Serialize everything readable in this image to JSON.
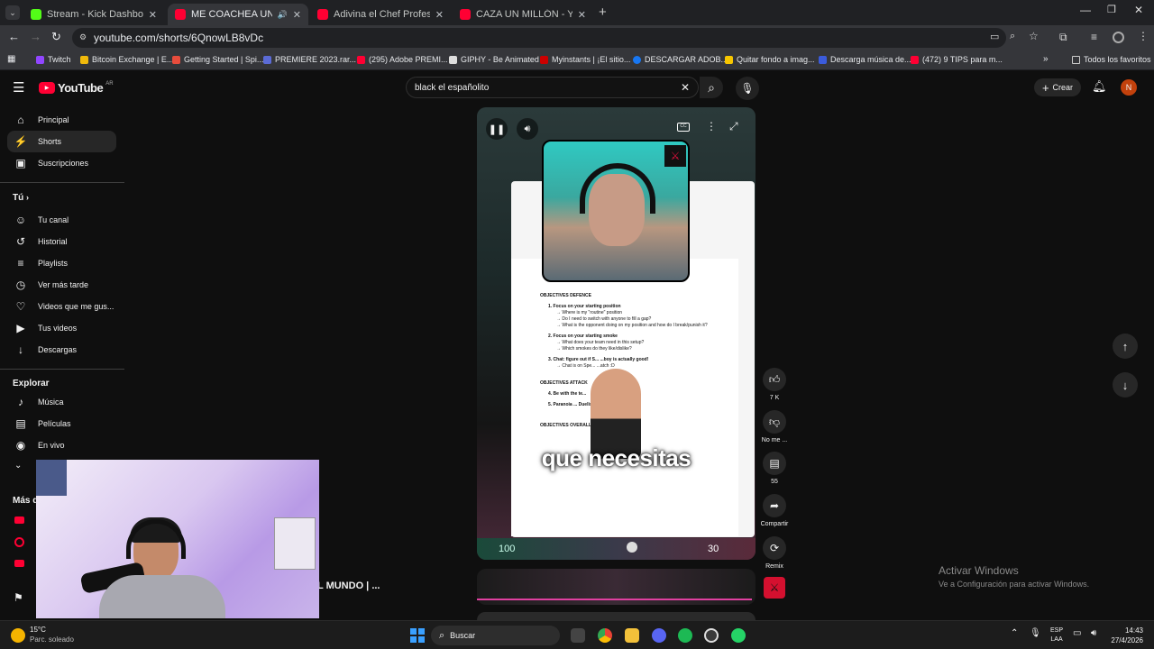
{
  "browser": {
    "tabs": [
      {
        "title": "Stream - Kick Dashboard",
        "color": "#53fc18"
      },
      {
        "title": "ME COACHEA UN EX CAM",
        "color": "#ff0033"
      },
      {
        "title": "Adivina el Chef Profesional - Yo",
        "color": "#ff0033"
      },
      {
        "title": "CAZA UN MILLÓN - YouTube",
        "color": "#ff0033"
      }
    ],
    "url": "youtube.com/shorts/6QnowLB8vDc",
    "bookmarks": [
      {
        "label": "Twitch",
        "color": "#9146ff"
      },
      {
        "label": "Bitcoin Exchange | E...",
        "color": "#f0b90b"
      },
      {
        "label": "Getting Started | Spi...",
        "color": "#e74c3c"
      },
      {
        "label": "PREMIERE 2023.rar...",
        "color": "#5b6bd6"
      },
      {
        "label": "(295) Adobe PREMI...",
        "color": "#ff0033"
      },
      {
        "label": "GIPHY - Be Animated",
        "color": "#dddddd"
      },
      {
        "label": "Myinstants | ¡El sitio...",
        "color": "#cc0000"
      },
      {
        "label": "DESCARGAR ADOB...",
        "color": "#1877f2"
      },
      {
        "label": "Quitar fondo a imag...",
        "color": "#f7c600"
      },
      {
        "label": "Descarga música de...",
        "color": "#3b5bdb"
      },
      {
        "label": "(472) 9 TIPS para m...",
        "color": "#ff0033"
      }
    ],
    "all_bookmarks": "Todos los favoritos"
  },
  "youtube": {
    "logo": "YouTube",
    "region": "AR",
    "search_value": "black el españolito",
    "create_label": "Crear",
    "avatar_letter": "N",
    "nav_main": [
      {
        "label": "Principal",
        "icon": "home-icon",
        "glyph": "⌂"
      },
      {
        "label": "Shorts",
        "icon": "shorts-icon",
        "glyph": "⚡"
      },
      {
        "label": "Suscripciones",
        "icon": "subscriptions-icon",
        "glyph": "▣"
      }
    ],
    "you_header": "Tú",
    "nav_you": [
      {
        "label": "Tu canal",
        "icon": "channel-icon",
        "glyph": "☺"
      },
      {
        "label": "Historial",
        "icon": "history-icon",
        "glyph": "↺"
      },
      {
        "label": "Playlists",
        "icon": "playlists-icon",
        "glyph": "≡"
      },
      {
        "label": "Ver más tarde",
        "icon": "watch-later-icon",
        "glyph": "◷"
      },
      {
        "label": "Videos que me gus...",
        "icon": "liked-icon",
        "glyph": "👍"
      },
      {
        "label": "Tus videos",
        "icon": "your-videos-icon",
        "glyph": "▶"
      },
      {
        "label": "Descargas",
        "icon": "downloads-icon",
        "glyph": "↓"
      }
    ],
    "explore_header": "Explorar",
    "nav_explore": [
      {
        "label": "Música",
        "icon": "music-icon",
        "glyph": "♪"
      },
      {
        "label": "Películas",
        "icon": "movies-icon",
        "glyph": "▤"
      },
      {
        "label": "En vivo",
        "icon": "live-icon",
        "glyph": "◉"
      }
    ],
    "more_header": "Más d",
    "behind_cam_text": "L MUNDO | ...",
    "short": {
      "caption": "que necesitas",
      "doc_lines": [
        "OBJECTIVES DEFENCE",
        "1. Focus on your starting position",
        "→ Where is my \"routine\" position",
        "→ Do I need to switch with anyone to fill a gap?",
        "→ What is the opponent doing on my position and how do I break/punish it?",
        "2. Focus on your starting smoke",
        "→ What does your team need in this setup?",
        "→ Which smokes do they like/dislike?",
        "3. Chat: figure out if S... ...boy is actually good!",
        "→ Chat is on Spe... ...atch :D",
        "OBJECTIVES ATTACK",
        "4. Be with the te...",
        "5. Paranoia ... Duelist",
        "OBJECTIVES OVERALL"
      ],
      "hud_left": "100",
      "hud_right": "30"
    },
    "actions": {
      "likes": "7 K",
      "dislike": "No me ...",
      "comments": "55",
      "share": "Compartir",
      "remix": "Remix"
    },
    "watermark_title": "Activar Windows",
    "watermark_sub": "Ve a Configuración para activar Windows."
  },
  "taskbar": {
    "temp": "15°C",
    "weather": "Parc. soleado",
    "search": "Buscar",
    "lang": "ESP",
    "lang2": "LAA",
    "time": "14:43",
    "date": "27/4/2026"
  }
}
